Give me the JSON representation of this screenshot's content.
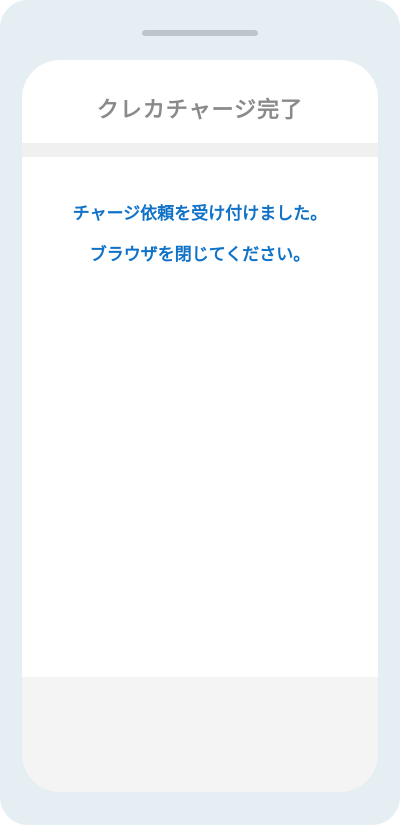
{
  "header": {
    "title": "クレカチャージ完了"
  },
  "main": {
    "message_line1": "チャージ依頼を受け付けました。",
    "message_line2": "ブラウザを閉じてください。"
  },
  "colors": {
    "frame": "#e5eef2",
    "title_text": "#8a8a8a",
    "message_text": "#0f72c7",
    "screen_background": "#ffffff",
    "footer_background": "#f4f4f4"
  }
}
